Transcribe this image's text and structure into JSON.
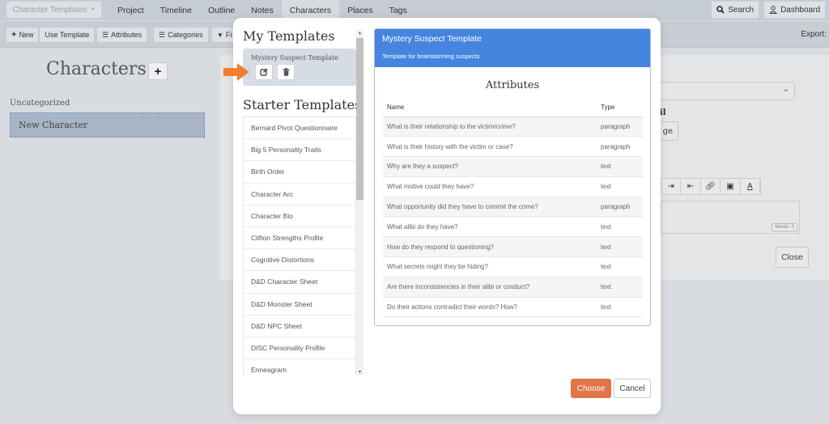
{
  "topnav": {
    "template_dropdown": "Character Templates",
    "links": [
      {
        "label": "Project",
        "active": false
      },
      {
        "label": "Timeline",
        "active": false
      },
      {
        "label": "Outline",
        "active": false
      },
      {
        "label": "Notes",
        "active": false
      },
      {
        "label": "Characters",
        "active": true
      },
      {
        "label": "Places",
        "active": false
      },
      {
        "label": "Tags",
        "active": false
      }
    ],
    "search_label": "Search",
    "dashboard_label": "Dashboard"
  },
  "toolbar": {
    "new_label": "New",
    "use_template_label": "Use Template",
    "attributes_label": "Attributes",
    "categories_label": "Categories",
    "filter_label": "Fi",
    "export_label": "Export:"
  },
  "sidebar": {
    "title": "Characters",
    "category": "Uncategorized",
    "characters": [
      "New Character"
    ]
  },
  "background": {
    "label_partial": "il",
    "image_button_partial": "ge",
    "words_count": "Words: 0",
    "close_label": "Close"
  },
  "modal": {
    "my_templates_title": "My Templates",
    "my_templates": [
      {
        "name": "Mystery Suspect Template"
      }
    ],
    "starter_templates_title": "Starter Templates",
    "starter_templates": [
      "Bernard Pivot Questionnaire",
      "Big 5 Personality Traits",
      "Birth Order",
      "Character Arc",
      "Character Bio",
      "Clifton Strengths Profile",
      "Cognitive Distortions",
      "D&D Character Sheet",
      "D&D Monster Sheet",
      "D&D NPC Sheet",
      "DISC Personality Profile",
      "Enneagram"
    ],
    "detail": {
      "title": "Mystery Suspect Template",
      "description": "Template for brainstorming suspects",
      "attributes_heading": "Attributes",
      "columns": [
        "Name",
        "Type"
      ],
      "rows": [
        {
          "name": "What is their relationship to the victim/crime?",
          "type": "paragraph"
        },
        {
          "name": "What is their history with the victim or case?",
          "type": "paragraph"
        },
        {
          "name": "Why are they a suspect?",
          "type": "text"
        },
        {
          "name": "What motive could they have?",
          "type": "text"
        },
        {
          "name": "What opportunity did they have to commit the crime?",
          "type": "paragraph"
        },
        {
          "name": "What alibi do they have?",
          "type": "text"
        },
        {
          "name": "How do they respond to questioning?",
          "type": "text"
        },
        {
          "name": "What secrets might they be hiding?",
          "type": "text"
        },
        {
          "name": "Are there inconsistencies in their alibi or conduct?",
          "type": "text"
        },
        {
          "name": "Do their actions contradict their words? How?",
          "type": "text"
        }
      ]
    },
    "choose_label": "Choose",
    "cancel_label": "Cancel"
  },
  "colors": {
    "accent_blue": "#4585e0",
    "choose_orange": "#e07548",
    "arrow_orange": "#f08030"
  }
}
